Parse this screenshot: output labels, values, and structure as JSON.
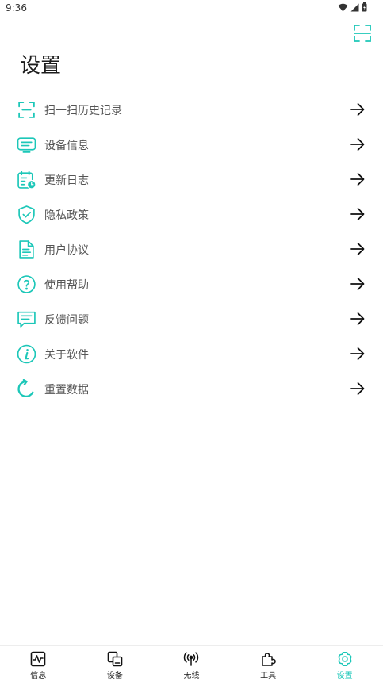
{
  "status_bar": {
    "time": "9:36",
    "icons": [
      "wifi-icon",
      "signal-icon",
      "battery-icon"
    ]
  },
  "header": {
    "title": "设置",
    "scan_icon": "scan-icon"
  },
  "accent_color": "#1cc7b8",
  "menu": {
    "items": [
      {
        "label": "扫一扫历史记录",
        "icon": "scan-icon"
      },
      {
        "label": "设备信息",
        "icon": "device-info-icon"
      },
      {
        "label": "更新日志",
        "icon": "calendar-clock-icon"
      },
      {
        "label": "隐私政策",
        "icon": "shield-check-icon"
      },
      {
        "label": "用户协议",
        "icon": "document-icon"
      },
      {
        "label": "使用帮助",
        "icon": "help-icon"
      },
      {
        "label": "反馈问题",
        "icon": "feedback-icon"
      },
      {
        "label": "关于软件",
        "icon": "info-icon"
      },
      {
        "label": "重置数据",
        "icon": "refresh-icon"
      }
    ],
    "arrow_icon": "arrow-right-icon"
  },
  "bottom_nav": {
    "tabs": [
      {
        "label": "信息",
        "icon": "activity-icon",
        "active": false
      },
      {
        "label": "设备",
        "icon": "devices-icon",
        "active": false
      },
      {
        "label": "无线",
        "icon": "wireless-icon",
        "active": false
      },
      {
        "label": "工具",
        "icon": "puzzle-icon",
        "active": false
      },
      {
        "label": "设置",
        "icon": "settings-icon",
        "active": true
      }
    ]
  }
}
